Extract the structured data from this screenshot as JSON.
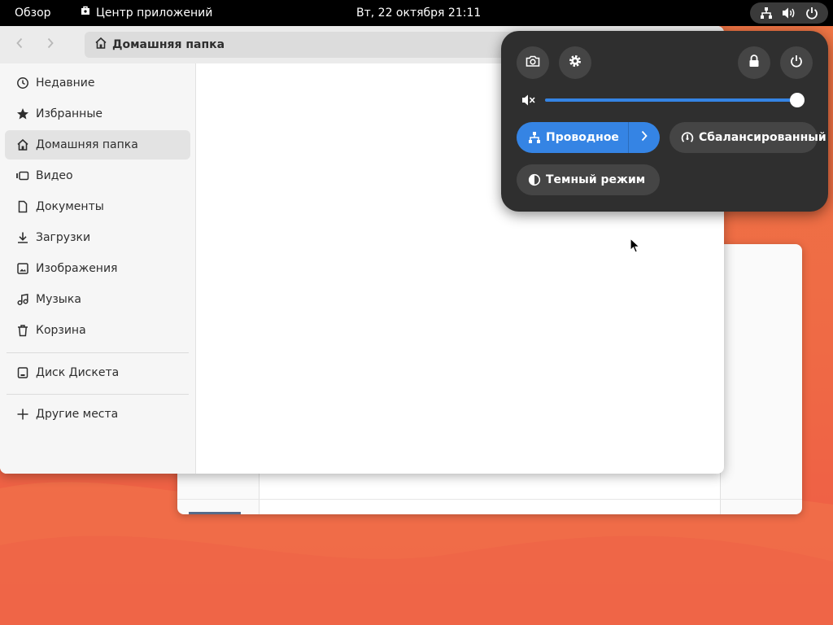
{
  "topbar": {
    "overview": "Обзор",
    "app_name": "Центр приложений",
    "clock": "Вт, 22 октября  21:11",
    "tray_icons": [
      "network-wired-icon",
      "volume-icon",
      "power-icon"
    ]
  },
  "files": {
    "path_label": "Домашняя папка",
    "sidebar": {
      "items": [
        {
          "label": "Недавние",
          "icon": "clock-icon"
        },
        {
          "label": "Избранные",
          "icon": "star-icon"
        },
        {
          "label": "Домашняя папка",
          "icon": "home-icon",
          "active": true
        },
        {
          "label": "Видео",
          "icon": "video-icon"
        },
        {
          "label": "Документы",
          "icon": "document-icon"
        },
        {
          "label": "Загрузки",
          "icon": "download-icon"
        },
        {
          "label": "Изображения",
          "icon": "image-icon"
        },
        {
          "label": "Музыка",
          "icon": "music-icon"
        },
        {
          "label": "Корзина",
          "icon": "trash-icon"
        }
      ],
      "devices": [
        {
          "label": "Диск Дискета",
          "icon": "drive-icon"
        }
      ],
      "other": {
        "label": "Другие места",
        "icon": "plus-icon"
      }
    }
  },
  "quick_settings": {
    "volume_level": 0.98,
    "network": {
      "label": "Проводное",
      "active": true
    },
    "power_mode": {
      "label": "Сбалансированный"
    },
    "dark_mode": {
      "label": "Темный режим"
    },
    "accent_color": "#3584e4"
  }
}
